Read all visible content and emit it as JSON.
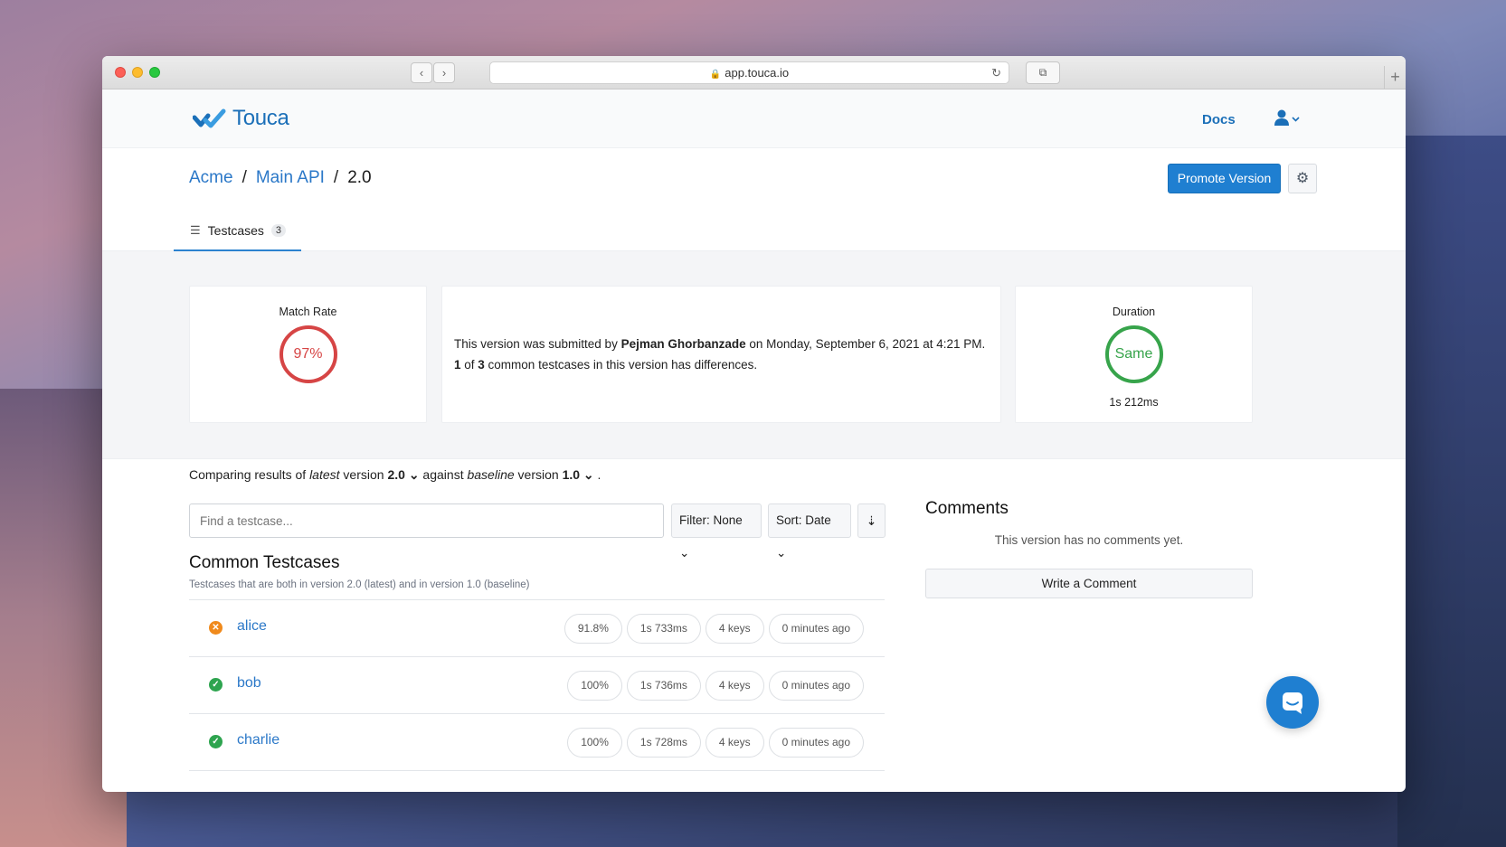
{
  "browser": {
    "url": "app.touca.io",
    "icons": {
      "back": "chevron-left-icon",
      "forward": "chevron-right-icon",
      "lock": "lock-icon",
      "reload": "reload-icon",
      "tabs": "tabs-icon",
      "new_tab": "plus-icon"
    }
  },
  "nav": {
    "logo_text": "Touca",
    "docs_label": "Docs",
    "user_icon": "user-icon"
  },
  "breadcrumb": {
    "team": "Acme",
    "suite": "Main API",
    "version": "2.0",
    "separator": "/"
  },
  "actions": {
    "promote_label": "Promote Version",
    "settings_icon": "gear-icon"
  },
  "tabs": [
    {
      "label": "Testcases",
      "count": "3",
      "icon": "list-icon"
    }
  ],
  "summary": {
    "match_rate_title": "Match Rate",
    "match_rate_value": "97%",
    "submitted_text_1": "This version was submitted by ",
    "submitter": "Pejman Ghorbanzade",
    "submitted_text_2": " on Monday, September 6, 2021 at 4:21 PM.",
    "diff_count": "1",
    "diff_of": " of ",
    "diff_total": "3",
    "diff_text": " common testcases in this version has differences.",
    "duration_title": "Duration",
    "duration_value": "Same",
    "duration_time": "1s 212ms"
  },
  "compare": {
    "prefix": "Comparing results of ",
    "latest_word": "latest",
    "mid1": " version ",
    "latest_version": "2.0",
    "against": " against ",
    "baseline_word": "baseline",
    "mid2": " version ",
    "baseline_version": "1.0",
    "suffix": " ."
  },
  "controls": {
    "search_placeholder": "Find a testcase...",
    "filter_label": "Filter: None",
    "sort_label": "Sort: Date",
    "sort_order_icon": "sort-descending-icon"
  },
  "common": {
    "title": "Common Testcases",
    "subtitle": "Testcases that are both in version 2.0 (latest) and in version 1.0 (baseline)",
    "rows": [
      {
        "name": "alice",
        "status": "fail",
        "match": "91.8%",
        "time": "1s 733ms",
        "keys": "4 keys",
        "ago": "0 minutes ago"
      },
      {
        "name": "bob",
        "status": "ok",
        "match": "100%",
        "time": "1s 736ms",
        "keys": "4 keys",
        "ago": "0 minutes ago"
      },
      {
        "name": "charlie",
        "status": "ok",
        "match": "100%",
        "time": "1s 728ms",
        "keys": "4 keys",
        "ago": "0 minutes ago"
      }
    ]
  },
  "comments": {
    "title": "Comments",
    "empty_text": "This version has no comments yet.",
    "write_label": "Write a Comment"
  },
  "colors": {
    "accent": "#1f7fd1",
    "danger": "#d64545",
    "success": "#37a44b",
    "warning": "#f08a1c"
  }
}
